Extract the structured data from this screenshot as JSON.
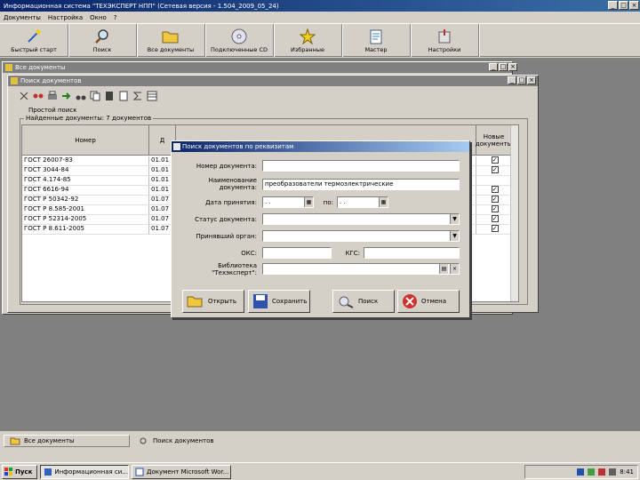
{
  "window": {
    "title": "Информационная система \"ТЕХЭКСПЕРТ НПП\" (Сетевая версия - 1.504_2009_05_24)"
  },
  "menu": [
    "Документы",
    "Настройка",
    "Окно",
    "?"
  ],
  "toolbar": [
    {
      "label": "Быстрый старт",
      "icon": "wand-icon"
    },
    {
      "label": "Поиск",
      "icon": "magnifier-icon"
    },
    {
      "label": "Все документы",
      "icon": "folder-icon"
    },
    {
      "label": "Подключенные CD",
      "icon": "cd-icon",
      "badge": "СОНКУ"
    },
    {
      "label": "Избранные",
      "icon": "star-icon"
    },
    {
      "label": "Мастер",
      "icon": "notepad-icon"
    },
    {
      "label": "Настройки",
      "icon": "settings-icon"
    }
  ],
  "all_docs_window": {
    "title": "Все документы"
  },
  "search_window": {
    "title": "Поиск документов"
  },
  "tabs": [
    "Простой поиск",
    "Найденные документы: 7 документов"
  ],
  "grid": {
    "headers": {
      "number": "Номер",
      "date": "Д",
      "other": "",
      "new": "Новые документы"
    },
    "rows": [
      {
        "number": "ГОСТ 26007-83",
        "date": "01.01",
        "new": true
      },
      {
        "number": "ГОСТ 3044-84",
        "date": "01.01",
        "new": true
      },
      {
        "number": "ГОСТ 4.174-85",
        "date": "01.01",
        "new": false
      },
      {
        "number": "ГОСТ 6616-94",
        "date": "01.01",
        "new": true
      },
      {
        "number": "ГОСТ Р 50342-92",
        "date": "01.07",
        "new": true
      },
      {
        "number": "ГОСТ Р 8.585-2001",
        "date": "01.07",
        "new": true
      },
      {
        "number": "ГОСТ Р 52314-2005",
        "date": "01.07",
        "new": true
      },
      {
        "number": "ГОСТ Р 8.611-2005",
        "date": "01.07",
        "new": true
      }
    ]
  },
  "dialog": {
    "title": "Поиск документов по реквизитам",
    "fields": {
      "doc_number": {
        "label": "Номер документа:",
        "value": ""
      },
      "doc_name": {
        "label": "Наименование документа:",
        "value": "преобразователи термоэлектрические"
      },
      "accept_date": {
        "label": "Дата принятия:",
        "value": "  .  .",
        "to_label": "по:",
        "to_value": "  .  ."
      },
      "status": {
        "label": "Статус документа:",
        "value": ""
      },
      "organ": {
        "label": "Принявший орган:",
        "value": ""
      },
      "oks": {
        "label": "ОКС:",
        "value": ""
      },
      "kgs": {
        "label": "КГС:",
        "value": ""
      },
      "library": {
        "label": "Библиотека \"Техэксперт\":",
        "value": ""
      }
    },
    "buttons": {
      "open": "Открыть",
      "save": "Сохранить",
      "search": "Поиск",
      "cancel": "Отмена"
    }
  },
  "bottom_tabs": [
    "Все документы",
    "Поиск документов"
  ],
  "taskbar": {
    "start": "Пуск",
    "tasks": [
      "Информационная си...",
      "Документ Microsoft Wor..."
    ],
    "clock": "8:41"
  }
}
